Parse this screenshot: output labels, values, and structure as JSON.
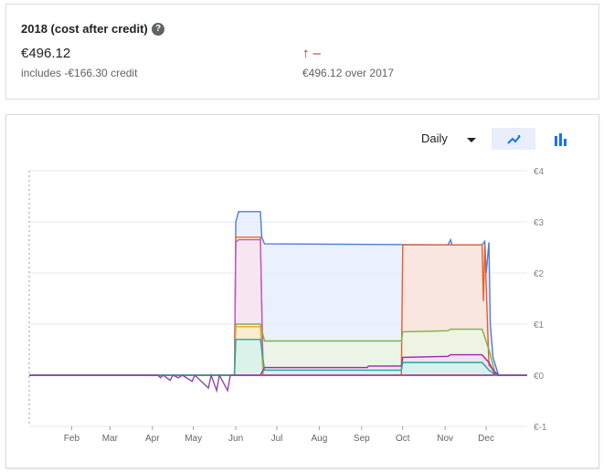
{
  "summary": {
    "title": "2018 (cost after credit)",
    "help_icon": "help-icon",
    "help_glyph": "?",
    "amount": "€496.12",
    "credit_text": "includes -€166.30 credit",
    "trend_arrow": "↑",
    "trend_dash": "–",
    "trend_color": "#c5221f",
    "compare_text": "€496.12 over 2017"
  },
  "controls": {
    "period": "Daily",
    "line_icon": "line-chart-icon",
    "bar_icon": "bar-chart-icon"
  },
  "chart_data": {
    "type": "area",
    "x_ticks": [
      "Feb",
      "Mar",
      "Apr",
      "May",
      "Jun",
      "Jul",
      "Aug",
      "Sep",
      "Oct",
      "Nov",
      "Dec"
    ],
    "y_ticks": [
      "€4",
      "€3",
      "€2",
      "€1",
      "€0",
      "€-1"
    ],
    "ylim": [
      -1,
      4
    ],
    "grid": true,
    "series": [
      {
        "color": "#4e7cd9",
        "fill": "#e6edfb",
        "points": [
          [
            "2018-01-01",
            0
          ],
          [
            "2018-05-31",
            0
          ],
          [
            "2018-06-01",
            3.0
          ],
          [
            "2018-06-03",
            3.2
          ],
          [
            "2018-06-19",
            3.2
          ],
          [
            "2018-06-20",
            2.7
          ],
          [
            "2018-06-22",
            2.57
          ],
          [
            "2018-11-03",
            2.55
          ],
          [
            "2018-11-05",
            2.65
          ],
          [
            "2018-11-06",
            2.55
          ],
          [
            "2018-11-28",
            2.55
          ],
          [
            "2018-11-30",
            2.62
          ],
          [
            "2018-12-01",
            2.0
          ],
          [
            "2018-12-03",
            2.6
          ],
          [
            "2018-12-04",
            1.0
          ],
          [
            "2018-12-06",
            0.35
          ],
          [
            "2018-12-10",
            0
          ],
          [
            "2018-12-31",
            0
          ]
        ]
      },
      {
        "color": "#e8602c",
        "fill": "#fde4da",
        "points": [
          [
            "2018-01-01",
            0
          ],
          [
            "2018-09-30",
            0
          ],
          [
            "2018-10-01",
            2.55
          ],
          [
            "2018-11-28",
            2.55
          ],
          [
            "2018-11-29",
            1.45
          ],
          [
            "2018-11-30",
            2.55
          ],
          [
            "2018-12-03",
            0.2
          ],
          [
            "2018-12-10",
            0
          ],
          [
            "2018-12-31",
            0
          ]
        ]
      },
      {
        "color": "#ee6a2e",
        "fill": "#fdecd9",
        "points": [
          [
            "2018-01-01",
            0
          ],
          [
            "2018-05-31",
            0
          ],
          [
            "2018-06-01",
            2.7
          ],
          [
            "2018-06-19",
            2.7
          ],
          [
            "2018-06-21",
            0
          ],
          [
            "2018-12-31",
            0
          ]
        ]
      },
      {
        "color": "#c158c8",
        "fill": "#f5e4f5",
        "points": [
          [
            "2018-01-01",
            0
          ],
          [
            "2018-05-31",
            0
          ],
          [
            "2018-06-01",
            2.6
          ],
          [
            "2018-06-03",
            2.65
          ],
          [
            "2018-06-19",
            2.65
          ],
          [
            "2018-06-21",
            0
          ],
          [
            "2018-12-31",
            0
          ]
        ]
      },
      {
        "color": "#7cb342",
        "fill": "#ecf4e3",
        "points": [
          [
            "2018-01-01",
            0
          ],
          [
            "2018-05-31",
            0
          ],
          [
            "2018-06-01",
            1.0
          ],
          [
            "2018-06-19",
            1.0
          ],
          [
            "2018-06-22",
            0.67
          ],
          [
            "2018-09-30",
            0.67
          ],
          [
            "2018-10-01",
            0.85
          ],
          [
            "2018-11-03",
            0.87
          ],
          [
            "2018-11-05",
            0.9
          ],
          [
            "2018-11-28",
            0.9
          ],
          [
            "2018-12-03",
            0.5
          ],
          [
            "2018-12-08",
            0
          ],
          [
            "2018-12-31",
            0
          ]
        ]
      },
      {
        "color": "#f4a31c",
        "fill": "#fdeccc",
        "points": [
          [
            "2018-01-01",
            0
          ],
          [
            "2018-05-31",
            0
          ],
          [
            "2018-06-01",
            0.95
          ],
          [
            "2018-06-19",
            0.95
          ],
          [
            "2018-06-21",
            0
          ],
          [
            "2018-12-31",
            0
          ]
        ]
      },
      {
        "color": "#9c27b0",
        "fill": "#f1def5",
        "points": [
          [
            "2018-01-01",
            0
          ],
          [
            "2018-06-19",
            0
          ],
          [
            "2018-06-22",
            0.15
          ],
          [
            "2018-09-05",
            0.15
          ],
          [
            "2018-09-06",
            0.18
          ],
          [
            "2018-09-30",
            0.18
          ],
          [
            "2018-10-01",
            0.35
          ],
          [
            "2018-11-03",
            0.37
          ],
          [
            "2018-11-05",
            0.4
          ],
          [
            "2018-11-28",
            0.4
          ],
          [
            "2018-12-03",
            0.25
          ],
          [
            "2018-12-08",
            0
          ],
          [
            "2018-12-31",
            0
          ]
        ]
      },
      {
        "color": "#26a69a",
        "fill": "#d5f2ee",
        "points": [
          [
            "2018-01-01",
            0
          ],
          [
            "2018-05-31",
            0
          ],
          [
            "2018-06-01",
            0.7
          ],
          [
            "2018-06-19",
            0.7
          ],
          [
            "2018-06-22",
            0.1
          ],
          [
            "2018-09-30",
            0.1
          ],
          [
            "2018-10-01",
            0.25
          ],
          [
            "2018-11-28",
            0.25
          ],
          [
            "2018-12-03",
            0.1
          ],
          [
            "2018-12-08",
            0
          ],
          [
            "2018-12-31",
            0
          ]
        ]
      },
      {
        "color": "#8e44ad",
        "fill": "none",
        "points": [
          [
            "2018-01-01",
            0
          ],
          [
            "2018-04-05",
            0
          ],
          [
            "2018-04-07",
            -0.05
          ],
          [
            "2018-04-09",
            0
          ],
          [
            "2018-04-14",
            -0.1
          ],
          [
            "2018-04-16",
            0
          ],
          [
            "2018-04-20",
            -0.05
          ],
          [
            "2018-04-23",
            0
          ],
          [
            "2018-04-30",
            -0.12
          ],
          [
            "2018-05-02",
            0
          ],
          [
            "2018-05-12",
            -0.25
          ],
          [
            "2018-05-14",
            0
          ],
          [
            "2018-05-18",
            -0.3
          ],
          [
            "2018-05-20",
            0
          ],
          [
            "2018-05-26",
            -0.3
          ],
          [
            "2018-05-28",
            0
          ],
          [
            "2018-12-06",
            0
          ],
          [
            "2018-12-08",
            0.05
          ],
          [
            "2018-12-10",
            0
          ],
          [
            "2018-12-31",
            0
          ]
        ]
      }
    ]
  }
}
